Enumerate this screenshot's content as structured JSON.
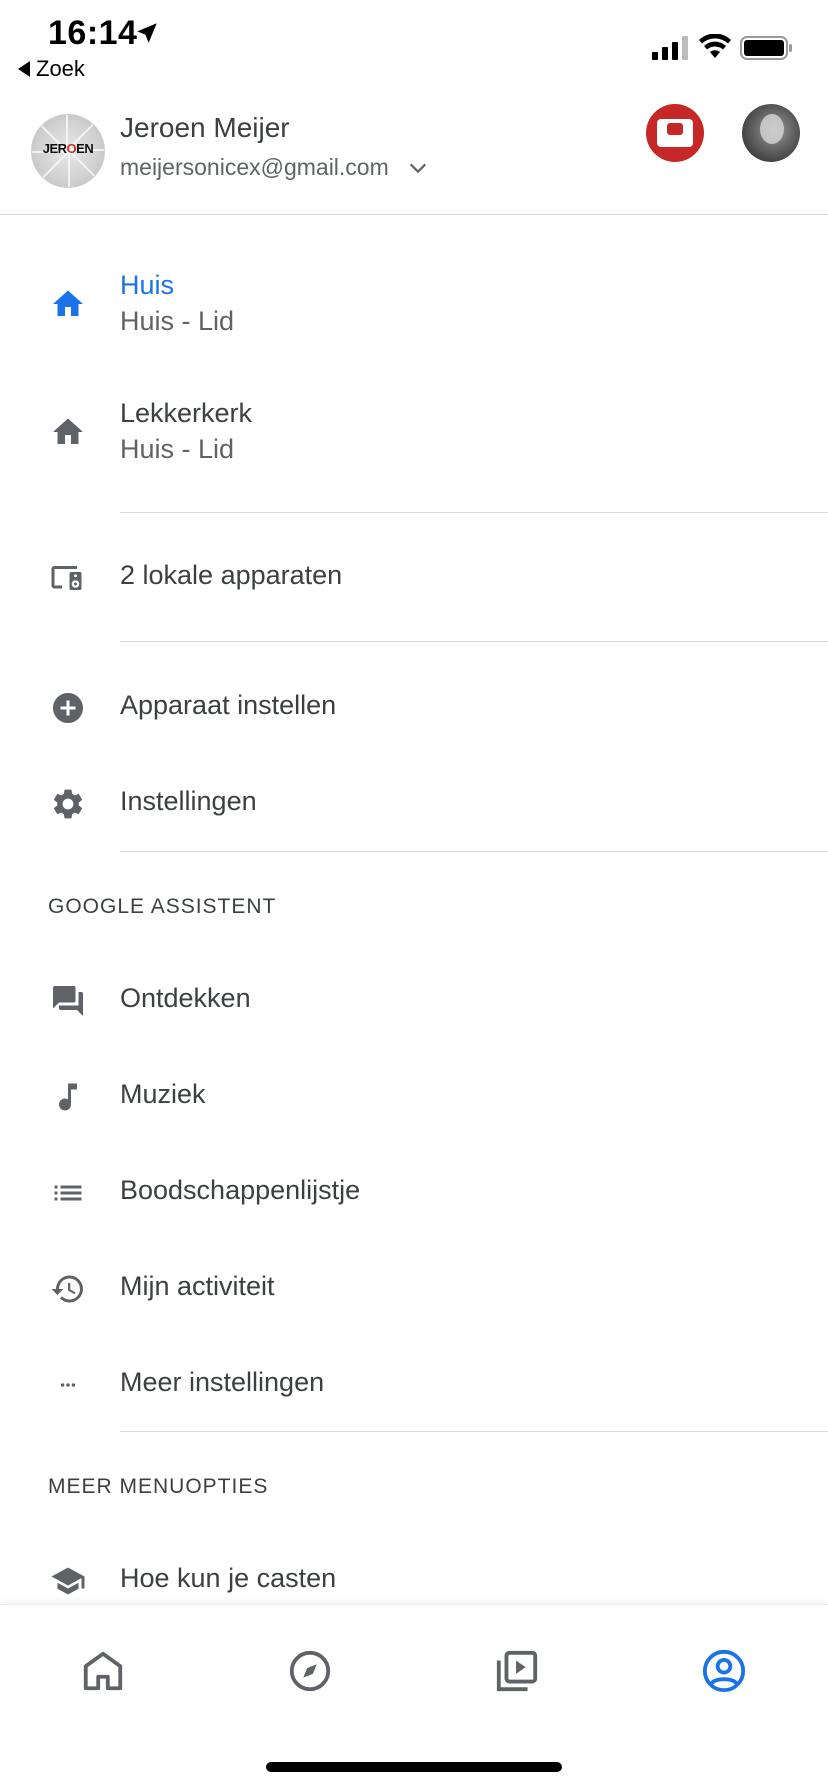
{
  "status_bar": {
    "time": "16:14",
    "back_label": "Zoek"
  },
  "account": {
    "name": "Jeroen Meijer",
    "email": "meijersonicex@gmail.com",
    "avatar_text_before": "JER",
    "avatar_text_o": "O",
    "avatar_text_after": "EN"
  },
  "homes": [
    {
      "title": "Huis",
      "subtitle": "Huis - Lid",
      "active": true
    },
    {
      "title": "Lekkerkerk",
      "subtitle": "Huis - Lid",
      "active": false
    }
  ],
  "local_devices": {
    "label": "2 lokale apparaten"
  },
  "actions": {
    "setup_device": "Apparaat instellen",
    "settings": "Instellingen"
  },
  "assistant_section": {
    "header": "GOOGLE ASSISTENT",
    "items": [
      {
        "label": "Ontdekken",
        "icon": "forum-icon"
      },
      {
        "label": "Muziek",
        "icon": "music-note-icon"
      },
      {
        "label": "Boodschappenlijstje",
        "icon": "list-icon"
      },
      {
        "label": "Mijn activiteit",
        "icon": "history-icon"
      },
      {
        "label": "Meer instellingen",
        "icon": "more-horiz-icon"
      }
    ]
  },
  "more_section": {
    "header": "MEER MENUOPTIES",
    "items": [
      {
        "label": "Hoe kun je casten",
        "icon": "school-icon"
      }
    ]
  },
  "bottom_nav": {
    "items": [
      "home-icon",
      "compass-icon",
      "media-icon",
      "account-icon"
    ],
    "active": "account-icon"
  },
  "colors": {
    "accent": "#1a73e8",
    "text_primary": "#3c4043",
    "text_secondary": "#5f6368",
    "divider": "#dadce0"
  }
}
